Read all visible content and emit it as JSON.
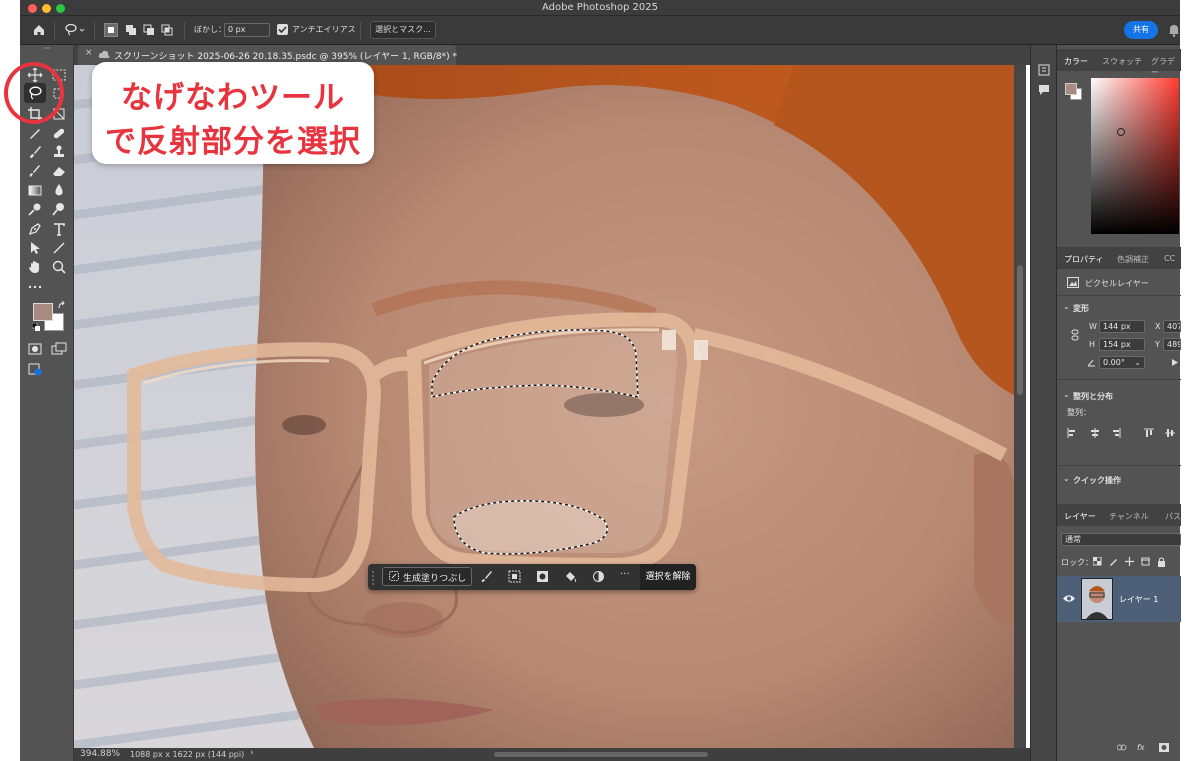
{
  "app_title": "Adobe Photoshop 2025",
  "options_bar": {
    "feather_label": "ぼかし：",
    "feather_value": "0 px",
    "antialias_label": "アンチエイリアス",
    "select_mask_label": "選択とマスク...",
    "share_label": "共有"
  },
  "document": {
    "tab_title": "スクリーンショット 2025-06-26 20.18.35.psdc @ 395% (レイヤー 1, RGB/8*) *",
    "zoom": "394.88%",
    "info": "1088 px x 1622 px (144 ppi)"
  },
  "callout": {
    "line1": "なげなわツール",
    "line2": "で反射部分を選択"
  },
  "task_bar": {
    "generative_fill_label": "生成塗りつぶし",
    "deselect_label": "選択を解除",
    "more_label": "···"
  },
  "color_panel": {
    "tabs": [
      "カラー",
      "スウォッチ",
      "グラデー"
    ]
  },
  "properties_panel": {
    "tabs": [
      "プロパティ",
      "色調補正",
      "CC"
    ],
    "layer_type": "ピクセルレイヤー",
    "transform_label": "変形",
    "w_label": "W",
    "w_value": "144 px",
    "h_label": "H",
    "h_value": "154 px",
    "x_label": "X",
    "x_value": "407",
    "y_label": "Y",
    "y_value": "489",
    "angle_value": "0.00°",
    "align_label": "整列と分布",
    "align_sub_label": "整列：",
    "quick_actions_label": "クイック操作"
  },
  "layers_panel": {
    "tabs": [
      "レイヤー",
      "チャンネル",
      "パス"
    ],
    "blend_mode": "通常",
    "lock_label": "ロック：",
    "layer_name": "レイヤー 1"
  },
  "colors": {
    "foreground": "#a88a80",
    "background": "#ffffff",
    "accent_blue": "#1473e6",
    "callout_red": "#e8343f"
  }
}
